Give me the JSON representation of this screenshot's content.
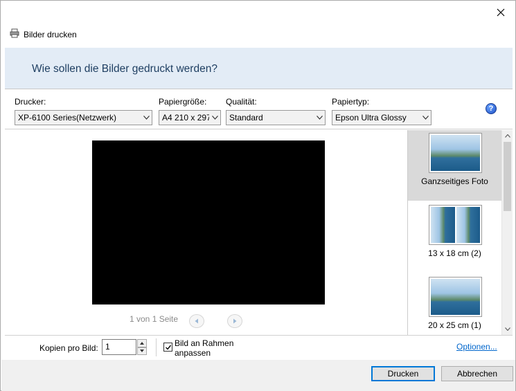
{
  "window": {
    "title": "Bilder drucken",
    "heading": "Wie sollen die Bilder gedruckt werden?"
  },
  "options": {
    "printer_label": "Drucker:",
    "printer_value": "XP-6100 Series(Netzwerk)",
    "paper_size_label": "Papiergröße:",
    "paper_size_value": "A4 210 x 297",
    "quality_label": "Qualität:",
    "quality_value": "Standard",
    "paper_type_label": "Papiertyp:",
    "paper_type_value": "Epson Ultra Glossy",
    "help_glyph": "?"
  },
  "preview": {
    "page_text": "1 von 1 Seite"
  },
  "layouts": [
    {
      "caption": "Ganzseitiges Foto",
      "selected": true
    },
    {
      "caption": "13 x 18 cm (2)",
      "selected": false
    },
    {
      "caption": "20 x 25 cm (1)",
      "selected": false
    }
  ],
  "bottom": {
    "copies_label": "Kopien pro Bild:",
    "copies_value": "1",
    "fit_label_line1": "Bild an Rahmen",
    "fit_label_line2": "anpassen",
    "fit_checked": true,
    "options_link": "Optionen..."
  },
  "footer": {
    "print_button": "Drucken",
    "cancel_button": "Abbrechen"
  },
  "colors": {
    "header_band": "#e3ecf6",
    "heading_text": "#1f3f62",
    "link": "#0066cc",
    "primary_border": "#0078d7"
  },
  "icons": {
    "app": "printer-icon",
    "close": "close-icon",
    "help": "help-icon"
  }
}
